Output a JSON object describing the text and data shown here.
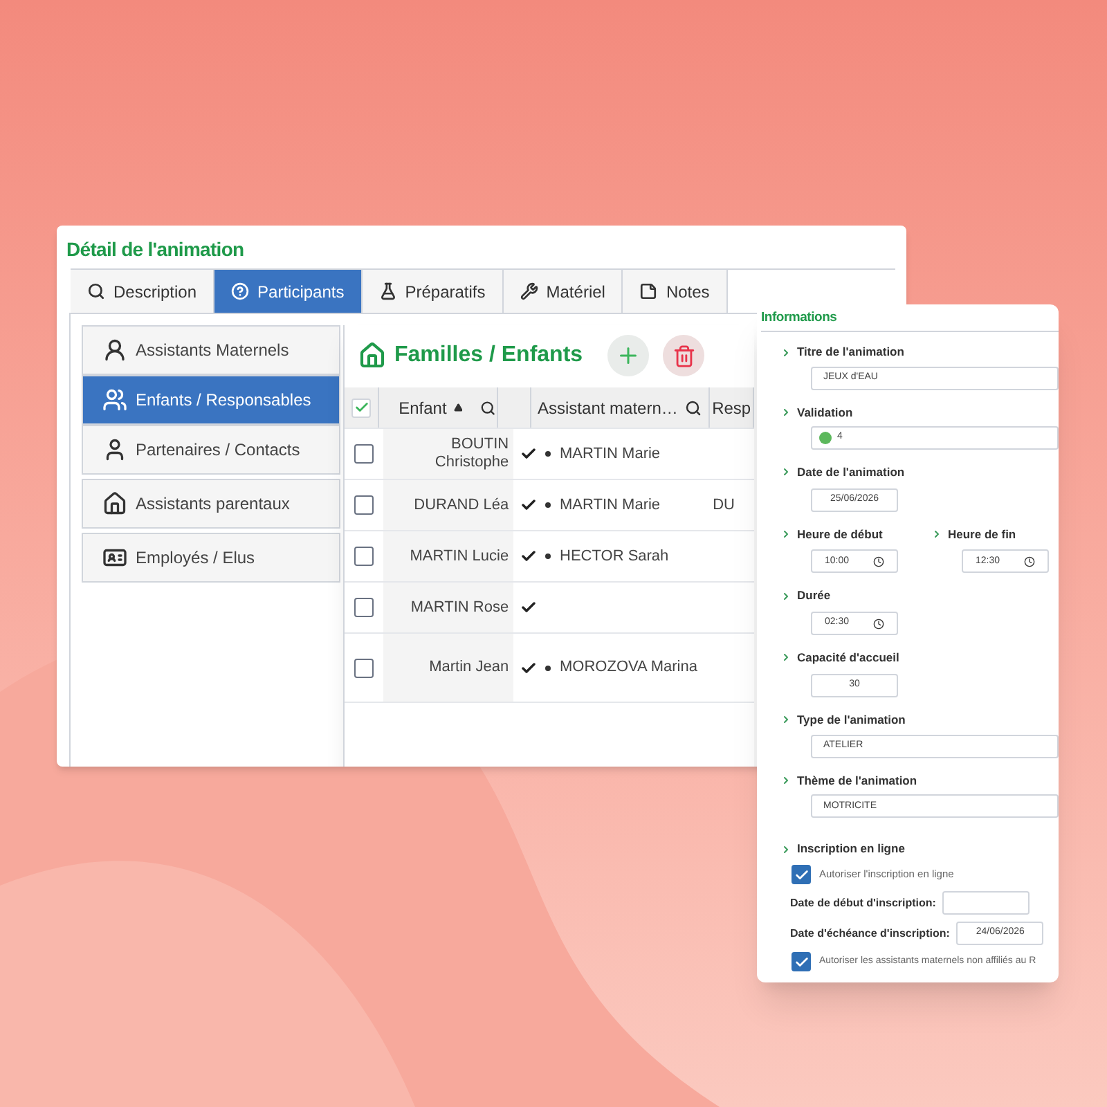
{
  "window": {
    "title": "Détail de l'animation"
  },
  "tabs": [
    {
      "label": "Description",
      "selected": false
    },
    {
      "label": "Participants",
      "selected": true
    },
    {
      "label": "Préparatifs",
      "selected": false
    },
    {
      "label": "Matériel",
      "selected": false
    },
    {
      "label": "Notes",
      "selected": false
    }
  ],
  "sidebar": {
    "items": [
      {
        "label": "Assistants Maternels",
        "selected": false
      },
      {
        "label": "Enfants / Responsables",
        "selected": true
      },
      {
        "label": "Partenaires / Contacts",
        "selected": false
      },
      {
        "label": "Assistants parentaux",
        "selected": false
      },
      {
        "label": "Employés / Elus",
        "selected": false
      }
    ]
  },
  "panel": {
    "title": "Familles / Enfants"
  },
  "table": {
    "header_checked": true,
    "columns": [
      {
        "label": "Enfant",
        "sorted": true,
        "searchable": true
      },
      {
        "label": "Assistant matern…",
        "sorted": false,
        "searchable": true
      },
      {
        "label": "Resp"
      }
    ],
    "rows": [
      {
        "checked": false,
        "child": "BOUTIN Christophe",
        "validated": true,
        "assistant": "MARTIN Marie"
      },
      {
        "checked": false,
        "child": "DURAND Léa",
        "validated": true,
        "assistant": "MARTIN Marie",
        "resp": "DU"
      },
      {
        "checked": false,
        "child": "MARTIN Lucie",
        "validated": true,
        "assistant": "HECTOR Sarah"
      },
      {
        "checked": false,
        "child": "MARTIN Rose",
        "validated": true
      },
      {
        "checked": false,
        "child": "Martin Jean",
        "validated": true,
        "assistant": "MOROZOVA Marina"
      }
    ]
  },
  "info": {
    "title": "Informations",
    "fields": [
      {
        "kind": "text",
        "label": "Titre de l'animation",
        "value": "JEUX d'EAU"
      },
      {
        "kind": "status",
        "label": "Validation",
        "value": "4",
        "color": "#5cb85c"
      },
      {
        "kind": "date",
        "label": "Date de l'animation",
        "value": "25/06/2026"
      },
      {
        "kind": "times",
        "items": [
          {
            "label": "Heure de début",
            "value": "10:00"
          },
          {
            "label": "Heure de fin",
            "value": "12:30"
          }
        ]
      },
      {
        "kind": "time",
        "label": "Durée",
        "value": "02:30"
      },
      {
        "kind": "date",
        "label": "Capacité d'accueil",
        "value": "30"
      },
      {
        "kind": "text",
        "label": "Type de l'animation",
        "value": "ATELIER"
      },
      {
        "kind": "text",
        "label": "Thème de l'animation",
        "value": "MOTRICITE"
      }
    ],
    "online": {
      "label": "Inscription en ligne",
      "allow": {
        "label": "Autoriser l'inscription en ligne",
        "checked": true
      },
      "start": {
        "label": "Date de début d'inscription:"
      },
      "end": {
        "label": "Date d'échéance d'inscription:",
        "value": "24/06/2026"
      },
      "non_affiliated": {
        "label": "Autoriser les assistants maternels non affiliés au R",
        "checked": true
      }
    }
  }
}
